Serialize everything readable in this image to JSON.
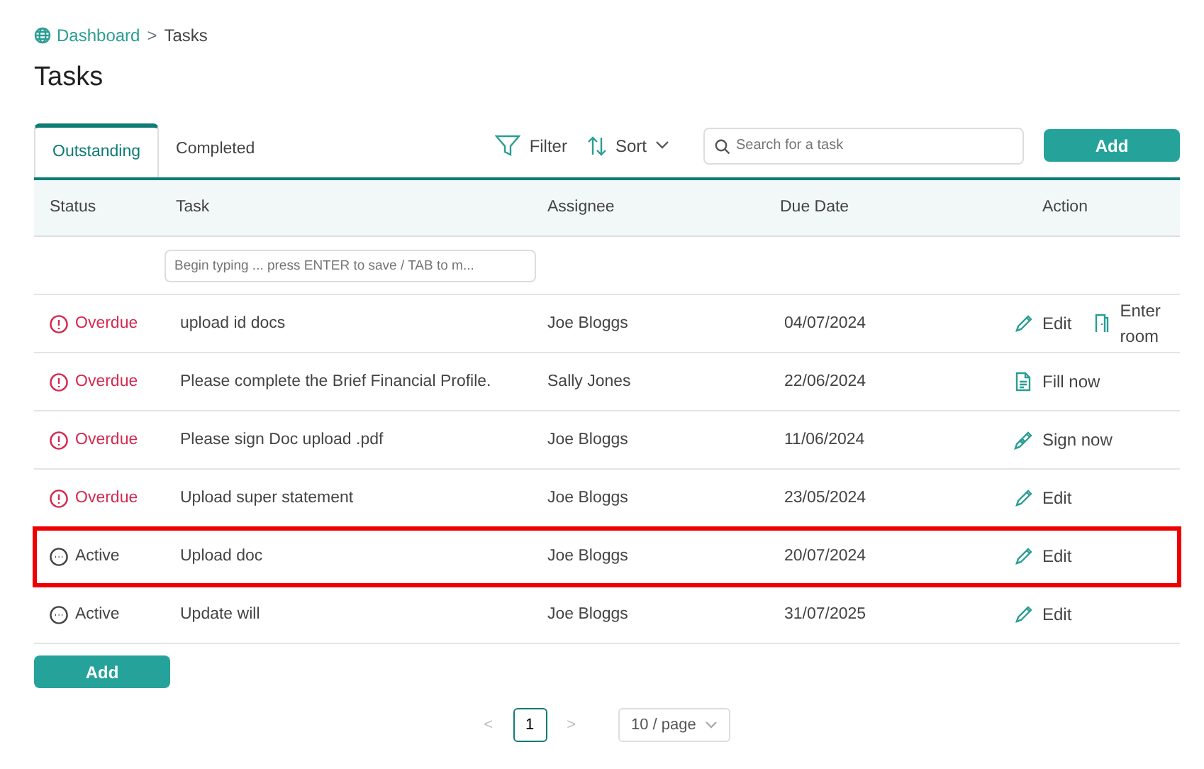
{
  "breadcrumb": {
    "home": "Dashboard",
    "separator": ">",
    "current": "Tasks"
  },
  "title": "Tasks",
  "tabs": [
    {
      "label": "Outstanding",
      "selected": true
    },
    {
      "label": "Completed",
      "selected": false
    }
  ],
  "toolbar": {
    "filter": "Filter",
    "sort": "Sort",
    "search": {
      "placeholder": "Search for a task"
    },
    "add": "Add"
  },
  "table": {
    "columns": [
      "Status",
      "Task",
      "Assignee",
      "Due Date",
      "Action"
    ],
    "new_task": {
      "placeholder": "Begin typing ... press ENTER to save / TAB to m..."
    },
    "rows": [
      {
        "status": "Overdue",
        "kind": "overdue",
        "task": "upload id docs",
        "assignee": "Joe Bloggs",
        "due": "04/07/2024",
        "highlighted": false,
        "actions": [
          {
            "kind": "edit",
            "label": "Edit"
          },
          {
            "kind": "enter",
            "label": "Enter room"
          }
        ]
      },
      {
        "status": "Overdue",
        "kind": "overdue",
        "task": "Please complete the Brief Financial Profile.",
        "assignee": "Sally Jones",
        "due": "22/06/2024",
        "highlighted": false,
        "actions": [
          {
            "kind": "fill",
            "label": "Fill now"
          }
        ]
      },
      {
        "status": "Overdue",
        "kind": "overdue",
        "task": "Please sign Doc upload .pdf",
        "assignee": "Joe Bloggs",
        "due": "11/06/2024",
        "highlighted": false,
        "actions": [
          {
            "kind": "sign",
            "label": "Sign now"
          }
        ]
      },
      {
        "status": "Overdue",
        "kind": "overdue",
        "task": "Upload super statement",
        "assignee": "Joe Bloggs",
        "due": "23/05/2024",
        "highlighted": false,
        "actions": [
          {
            "kind": "edit",
            "label": "Edit"
          }
        ]
      },
      {
        "status": "Active",
        "kind": "active",
        "task": "Upload doc",
        "assignee": "Joe Bloggs",
        "due": "20/07/2024",
        "highlighted": true,
        "actions": [
          {
            "kind": "edit",
            "label": "Edit"
          }
        ]
      },
      {
        "status": "Active",
        "kind": "active",
        "task": "Update will",
        "assignee": "Joe Bloggs",
        "due": "31/07/2025",
        "highlighted": false,
        "actions": [
          {
            "kind": "edit",
            "label": "Edit"
          }
        ]
      }
    ]
  },
  "add_button": "Add",
  "pagination": {
    "prev": "<",
    "pages": [
      {
        "label": "1",
        "selected": true
      }
    ],
    "next": ">",
    "page_size": "10 / page"
  }
}
